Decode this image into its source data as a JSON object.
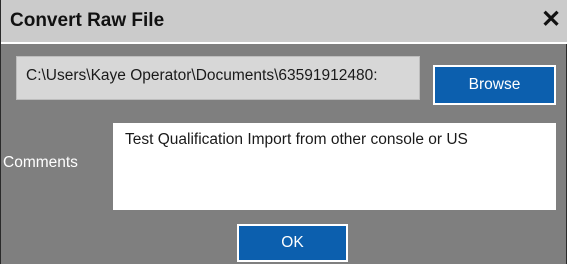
{
  "dialog": {
    "title": "Convert Raw File",
    "close_glyph": "✕",
    "close_icon": "close-icon"
  },
  "file": {
    "path": "C:\\Users\\Kaye Operator\\Documents\\63591912480:",
    "browse_label": "Browse"
  },
  "comments": {
    "label": "Comments",
    "value": "Test Qualification Import from other console or US"
  },
  "actions": {
    "ok_label": "OK"
  },
  "colors": {
    "titlebar": "#cbcbcb",
    "background": "#7f7f7f",
    "button": "#0c5fae"
  }
}
